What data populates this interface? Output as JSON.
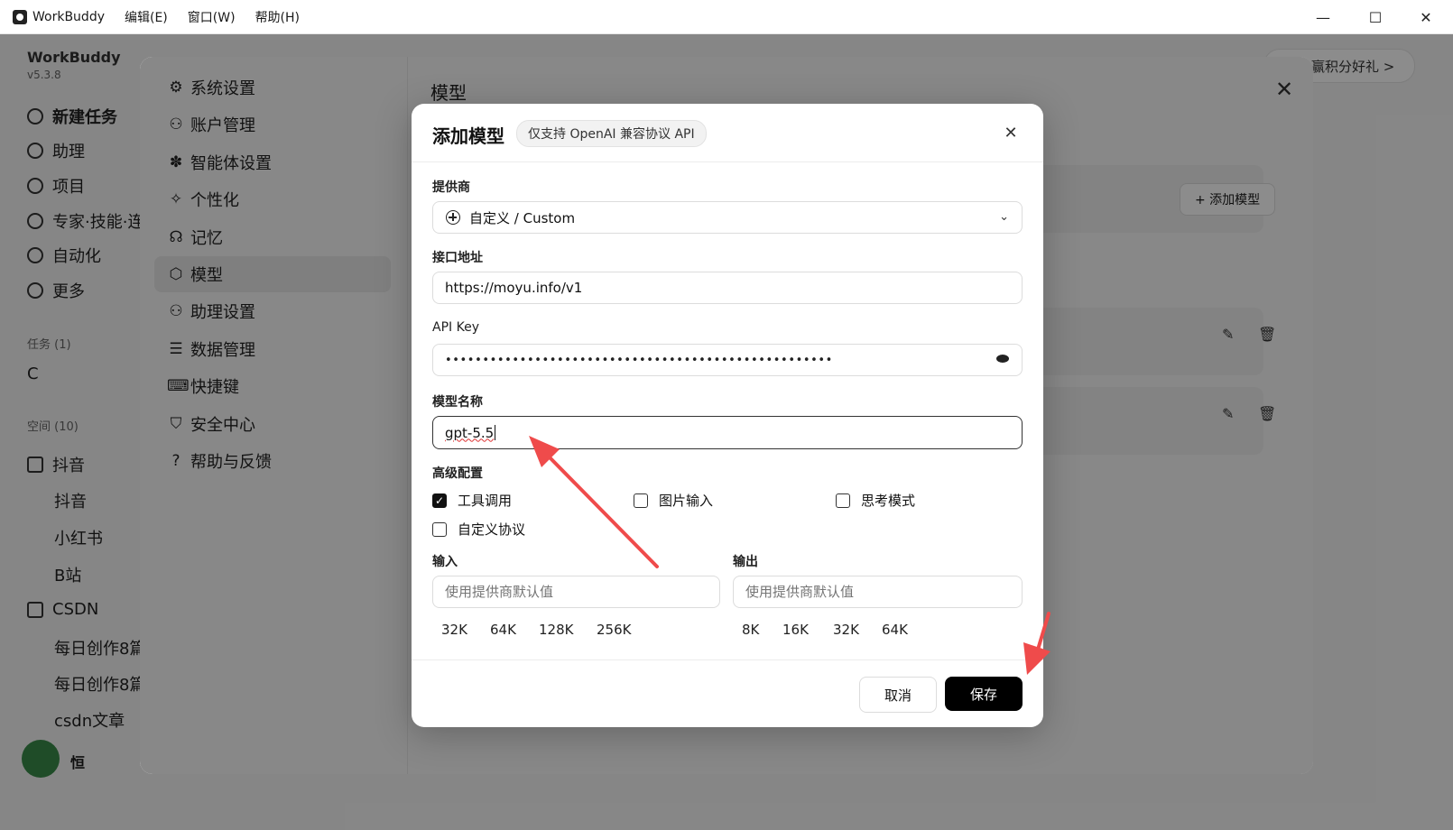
{
  "titlebar": {
    "app_name": "WorkBuddy",
    "menus": [
      "编辑(E)",
      "窗口(W)",
      "帮助(H)"
    ],
    "controls": {
      "minimize": "—",
      "maximize": "☐",
      "close": "✕"
    }
  },
  "sidebar": {
    "brand": "WorkBuddy",
    "version": "v5.3.8",
    "items": [
      {
        "label": "新建任务",
        "icon": "plus-circle-icon"
      },
      {
        "label": "助理",
        "icon": "robot-icon"
      },
      {
        "label": "项目",
        "icon": "project-icon"
      },
      {
        "label": "专家·技能·连",
        "icon": "expert-icon"
      },
      {
        "label": "自动化",
        "icon": "clock-icon"
      },
      {
        "label": "更多",
        "icon": "grid-icon"
      }
    ],
    "tasks_section": "任务 (1)",
    "task_item": "C",
    "spaces_section": "空间 (10)",
    "folders": [
      {
        "label": "抖音",
        "children": [
          "抖音",
          "小红书",
          "B站"
        ]
      },
      {
        "label": "CSDN",
        "children": [
          "每日创作8篇",
          "每日创作8篇",
          "csdn文章"
        ]
      }
    ],
    "user_name": "恒"
  },
  "promo_text": "任务赢积分好礼 >",
  "settings": {
    "title": "模型",
    "nav": [
      {
        "label": "系统设置",
        "icon": "gear-icon",
        "glyph": "⚙"
      },
      {
        "label": "账户管理",
        "icon": "user-icon",
        "glyph": "⚇"
      },
      {
        "label": "智能体设置",
        "icon": "puzzle-icon",
        "glyph": "✽"
      },
      {
        "label": "个性化",
        "icon": "sparkle-icon",
        "glyph": "✧"
      },
      {
        "label": "记忆",
        "icon": "brain-icon",
        "glyph": "☊"
      },
      {
        "label": "模型",
        "icon": "cube-icon",
        "glyph": "⬡"
      },
      {
        "label": "助理设置",
        "icon": "user-gear-icon",
        "glyph": "⚇"
      },
      {
        "label": "数据管理",
        "icon": "database-icon",
        "glyph": "☰"
      },
      {
        "label": "快捷键",
        "icon": "keyboard-icon",
        "glyph": "⌨"
      },
      {
        "label": "安全中心",
        "icon": "shield-icon",
        "glyph": "⛉"
      },
      {
        "label": "帮助与反馈",
        "icon": "help-icon",
        "glyph": "?"
      }
    ],
    "add_model_label": "+ 添加模型"
  },
  "modal": {
    "title": "添加模型",
    "badge": "仅支持 OpenAI 兼容协议 API",
    "provider_label": "提供商",
    "provider_value": "自定义 / Custom",
    "endpoint_label": "接口地址",
    "endpoint_value": "https://moyu.info/v1",
    "apikey_label": "API Key",
    "apikey_masked": "••••••••••••••••••••••••••••••••••••••••••••••••••••",
    "model_name_label": "模型名称",
    "model_name_value": "gpt-5.5",
    "advanced_label": "高级配置",
    "options": [
      {
        "label": "工具调用",
        "checked": true
      },
      {
        "label": "图片输入",
        "checked": false
      },
      {
        "label": "思考模式",
        "checked": false
      },
      {
        "label": "自定义协议",
        "checked": false
      }
    ],
    "input_label": "输入",
    "output_label": "输出",
    "input_placeholder": "使用提供商默认值",
    "output_placeholder": "使用提供商默认值",
    "input_chips": [
      "32K",
      "64K",
      "128K",
      "256K"
    ],
    "output_chips": [
      "8K",
      "16K",
      "32K",
      "64K"
    ],
    "cancel_label": "取消",
    "save_label": "保存"
  },
  "colors": {
    "accent": "#000000",
    "annotation_arrow": "#ef4b4b"
  }
}
